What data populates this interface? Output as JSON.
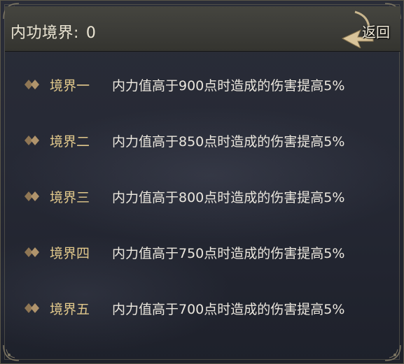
{
  "header": {
    "title_label": "内功境界:",
    "title_value": "0",
    "back_label": "返回"
  },
  "realms": [
    {
      "name": "境界一",
      "description": "内力值高于900点时造成的伤害提高5%"
    },
    {
      "name": "境界二",
      "description": "内力值高于850点时造成的伤害提高5%"
    },
    {
      "name": "境界三",
      "description": "内力值高于800点时造成的伤害提高5%"
    },
    {
      "name": "境界四",
      "description": "内力值高于750点时造成的伤害提高5%"
    },
    {
      "name": "境界五",
      "description": "内力值高于700点时造成的伤害提高5%"
    }
  ],
  "colors": {
    "realm_name": "#e2c98c",
    "description": "#ebe7de",
    "header_bg": "#3b3b37",
    "panel_bg": "#262935",
    "bullet": "#a98c68"
  },
  "icons": {
    "bullet": "double-diamond-icon",
    "back": "arrow-back-icon",
    "corner": "corner-ornament-icon"
  }
}
